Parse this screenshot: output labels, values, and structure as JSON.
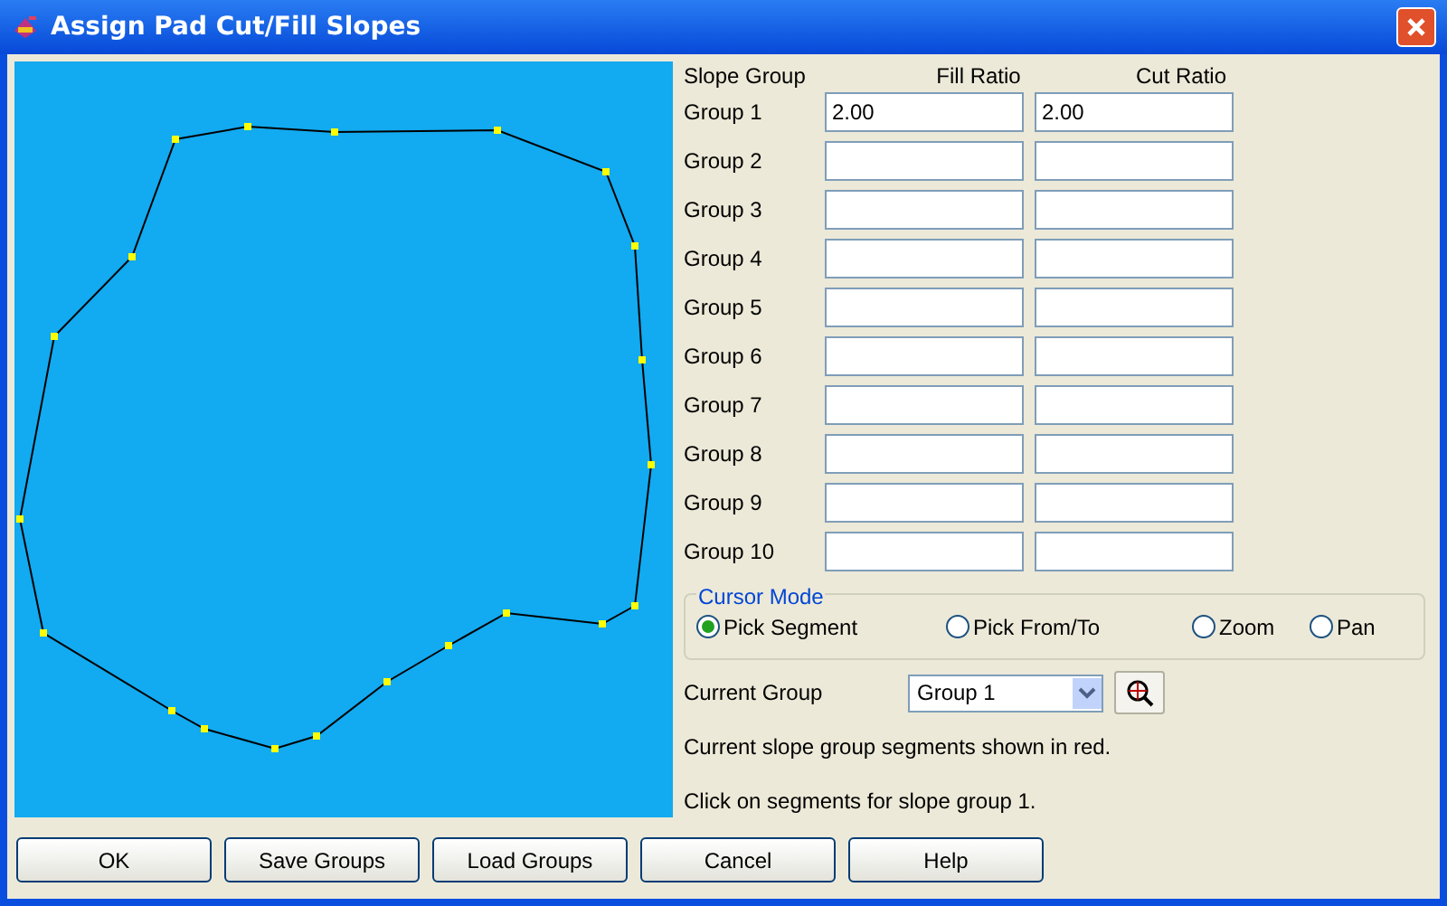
{
  "window": {
    "title": "Assign Pad Cut/Fill Slopes"
  },
  "table": {
    "columns": [
      "Slope Group",
      "Fill Ratio",
      "Cut Ratio"
    ],
    "rows": [
      {
        "label": "Group 1",
        "fill": "2.00",
        "cut": "2.00"
      },
      {
        "label": "Group 2"
      },
      {
        "label": "Group 3"
      },
      {
        "label": "Group 4"
      },
      {
        "label": "Group 5"
      },
      {
        "label": "Group 6"
      },
      {
        "label": "Group 7"
      },
      {
        "label": "Group 8"
      },
      {
        "label": "Group 9"
      },
      {
        "label": "Group 10"
      }
    ]
  },
  "cursor_mode": {
    "title": "Cursor Mode",
    "options": [
      {
        "label": "Pick Segment",
        "selected": true
      },
      {
        "label": "Pick From/To",
        "selected": false
      },
      {
        "label": "Zoom",
        "selected": false
      },
      {
        "label": "Pan",
        "selected": false
      }
    ]
  },
  "current_group": {
    "label": "Current Group",
    "value": "Group 1"
  },
  "messages": [
    "Current slope group segments shown in red.",
    "Click on segments for slope group 1."
  ],
  "buttons": [
    "OK",
    "Save Groups",
    "Load Groups",
    "Cancel",
    "Help"
  ]
}
